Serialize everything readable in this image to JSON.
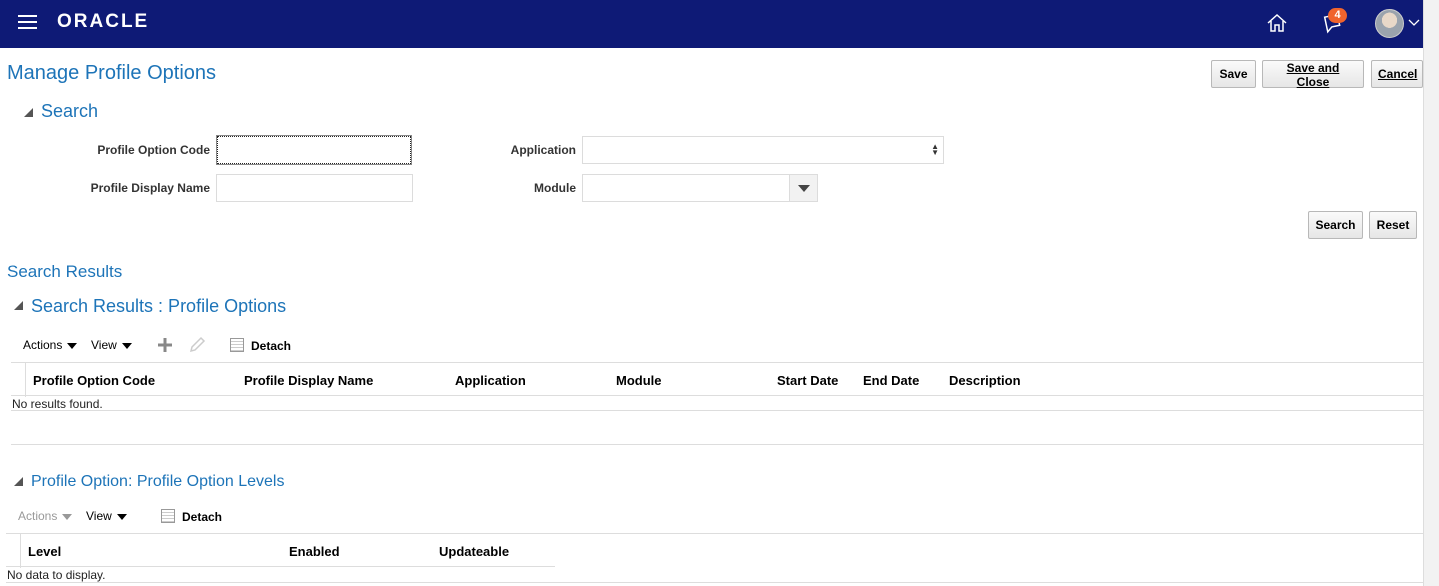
{
  "header": {
    "logo": "ORACLE",
    "notification_count": "4",
    "icons": [
      "menu-icon",
      "home-icon",
      "notifications-icon",
      "user-avatar",
      "chevron-down-icon"
    ]
  },
  "page": {
    "title": "Manage Profile Options",
    "buttons": {
      "save": "Save",
      "save_and_close": "Save and Close",
      "cancel": "Cancel"
    }
  },
  "search": {
    "heading": "Search",
    "fields": {
      "profile_option_code": {
        "label": "Profile Option Code",
        "value": ""
      },
      "profile_display_name": {
        "label": "Profile Display Name",
        "value": ""
      },
      "application": {
        "label": "Application",
        "value": ""
      },
      "module": {
        "label": "Module",
        "value": ""
      }
    },
    "buttons": {
      "search": "Search",
      "reset": "Reset"
    }
  },
  "results": {
    "heading": "Search Results",
    "subheading": "Search Results : Profile Options",
    "toolbar": {
      "actions": "Actions",
      "view": "View",
      "detach": "Detach"
    },
    "columns": [
      "Profile Option Code",
      "Profile Display Name",
      "Application",
      "Module",
      "Start Date",
      "End Date",
      "Description"
    ],
    "empty_message": "No results found."
  },
  "levels": {
    "heading": "Profile Option: Profile Option Levels",
    "toolbar": {
      "actions": "Actions",
      "view": "View",
      "detach": "Detach"
    },
    "columns": [
      "Level",
      "Enabled",
      "Updateable"
    ],
    "empty_message": "No data to display."
  },
  "colors": {
    "header_bg": "#0e1a76",
    "accent": "#1d74b8",
    "badge": "#f0642d"
  }
}
